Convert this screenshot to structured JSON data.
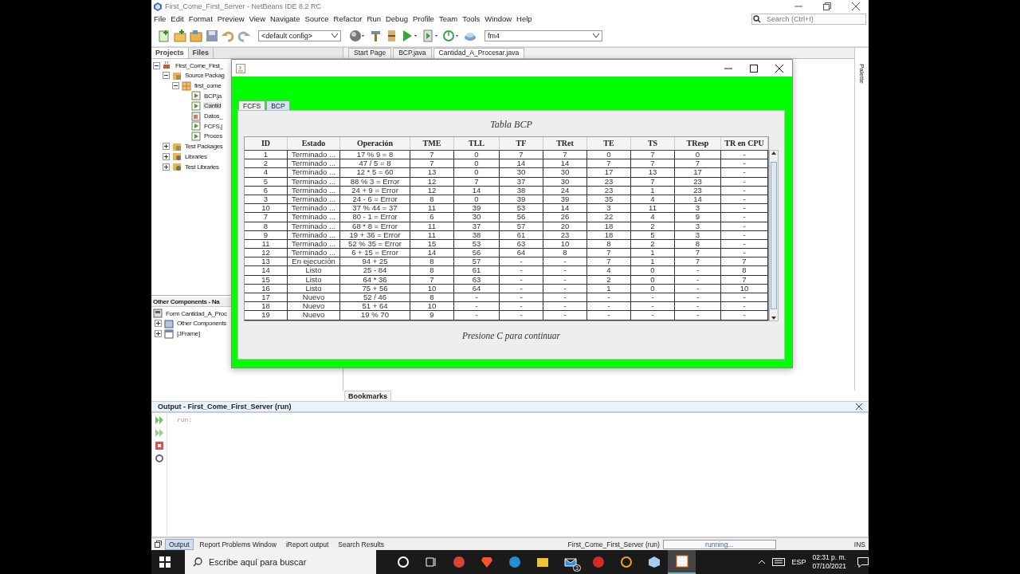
{
  "ide": {
    "title": "First_Come_First_Server - NetBeans IDE 8.2 RC",
    "menu": [
      "File",
      "Edit",
      "Format",
      "Preview",
      "View",
      "Navigate",
      "Source",
      "Refactor",
      "Run",
      "Debug",
      "Profile",
      "Team",
      "Tools",
      "Window",
      "Help"
    ],
    "toolbar": {
      "config": "<default config>",
      "target": "fm4",
      "search_placeholder": "Search (Ctrl+I)"
    },
    "project_tabs": [
      {
        "label": "Projects",
        "selected": true
      },
      {
        "label": "Files",
        "selected": false
      }
    ],
    "project_tree": [
      {
        "label": "First_Come_First_",
        "kind": "project",
        "expanded": true,
        "children": [
          {
            "label": "Source Packag",
            "kind": "folder",
            "expanded": true,
            "children": [
              {
                "label": "first_come",
                "kind": "package",
                "expanded": true,
                "children": [
                  {
                    "label": "BCP.ja",
                    "kind": "java",
                    "selected": false
                  },
                  {
                    "label": "Cantid",
                    "kind": "java",
                    "selected": true
                  },
                  {
                    "label": "Datos_",
                    "kind": "form",
                    "selected": false
                  },
                  {
                    "label": "FCFS.j",
                    "kind": "java",
                    "selected": false
                  },
                  {
                    "label": "Proces",
                    "kind": "java",
                    "selected": false
                  }
                ]
              }
            ]
          },
          {
            "label": "Test Packages",
            "kind": "folder",
            "expanded": false
          },
          {
            "label": "Libraries",
            "kind": "library",
            "expanded": false
          },
          {
            "label": "Test Libraries",
            "kind": "library",
            "expanded": false
          }
        ]
      }
    ],
    "navigator": {
      "title": "Other Components - Na",
      "items": [
        {
          "label": "Form Cantidad_A_Proc",
          "kind": "form"
        },
        {
          "label": "Other Components",
          "kind": "folder",
          "expanded": false
        },
        {
          "label": "[JFrame]",
          "kind": "frame",
          "expanded": false
        }
      ]
    },
    "editor_tabs": [
      {
        "label": "Start Page",
        "selected": false
      },
      {
        "label": "BCP.java",
        "selected": false
      },
      {
        "label": "Cantidad_A_Procesar.java",
        "selected": true
      }
    ],
    "side_panel": "Palette",
    "bookmarks_tab": "Bookmarks",
    "output": {
      "title": "Output - First_Come_First_Server (run)",
      "lines": [
        "run:"
      ]
    },
    "status_bar": {
      "tabs": [
        {
          "label": "Output",
          "selected": true
        },
        {
          "label": "Report Problems Window",
          "selected": false
        },
        {
          "label": "iReport output",
          "selected": false
        },
        {
          "label": "Search Results",
          "selected": false
        }
      ],
      "task": "First_Come_First_Server (run)",
      "progress": "running...",
      "mode": "INS"
    }
  },
  "app_window": {
    "tabs": [
      {
        "label": "FCFS",
        "selected": false
      },
      {
        "label": "BCP",
        "selected": true
      }
    ],
    "table_title": "Tabla BCP",
    "columns": [
      "ID",
      "Estado",
      "Operación",
      "TME",
      "TLL",
      "TF",
      "TRet",
      "TE",
      "TS",
      "TResp",
      "TR en CPU"
    ],
    "rows": [
      [
        "1",
        "Terminado ...",
        "17 % 9 = 8",
        "7",
        "0",
        "7",
        "7",
        "0",
        "7",
        "0",
        "-"
      ],
      [
        "2",
        "Terminado ...",
        "47 / 5 = 8",
        "7",
        "0",
        "14",
        "14",
        "7",
        "7",
        "7",
        "-"
      ],
      [
        "4",
        "Terminado ...",
        "12 * 5 = 60",
        "13",
        "0",
        "30",
        "30",
        "17",
        "13",
        "17",
        "-"
      ],
      [
        "5",
        "Terminado ...",
        "88 % 3 = Error",
        "12",
        "7",
        "37",
        "30",
        "23",
        "7",
        "23",
        "-"
      ],
      [
        "6",
        "Terminado ...",
        "24 + 9 = Error",
        "12",
        "14",
        "38",
        "24",
        "23",
        "1",
        "23",
        "-"
      ],
      [
        "3",
        "Terminado ...",
        "24 - 6 = Error",
        "8",
        "0",
        "39",
        "39",
        "35",
        "4",
        "14",
        "-"
      ],
      [
        "10",
        "Terminado ...",
        "37 % 44 = 37",
        "11",
        "39",
        "53",
        "14",
        "3",
        "11",
        "3",
        "-"
      ],
      [
        "7",
        "Terminado ...",
        "80 - 1 = Error",
        "6",
        "30",
        "56",
        "26",
        "22",
        "4",
        "9",
        "-"
      ],
      [
        "8",
        "Terminado ...",
        "68 * 8 = Error",
        "11",
        "37",
        "57",
        "20",
        "18",
        "2",
        "3",
        "-"
      ],
      [
        "9",
        "Terminado ...",
        "19 + 36 = Error",
        "11",
        "38",
        "61",
        "23",
        "18",
        "5",
        "3",
        "-"
      ],
      [
        "11",
        "Terminado ...",
        "52 % 35 = Error",
        "15",
        "53",
        "63",
        "10",
        "8",
        "2",
        "8",
        "-"
      ],
      [
        "12",
        "Terminado ...",
        "6 + 15 = Error",
        "14",
        "56",
        "64",
        "8",
        "7",
        "1",
        "7",
        "-"
      ],
      [
        "13",
        "En ejecución",
        "94 + 25",
        "8",
        "57",
        "-",
        "-",
        "7",
        "1",
        "7",
        "7"
      ],
      [
        "14",
        "Listo",
        "25 - 84",
        "8",
        "61",
        "-",
        "-",
        "4",
        "0",
        "-",
        "8"
      ],
      [
        "15",
        "Listo",
        "64 * 36",
        "7",
        "63",
        "-",
        "-",
        "2",
        "0",
        "-",
        "7"
      ],
      [
        "16",
        "Listo",
        "75 + 56",
        "10",
        "64",
        "-",
        "-",
        "1",
        "0",
        "-",
        "10"
      ],
      [
        "17",
        "Nuevo",
        "52 / 46",
        "8",
        "-",
        "-",
        "-",
        "-",
        "-",
        "-",
        "-"
      ],
      [
        "18",
        "Nuevo",
        "51 + 64",
        "10",
        "-",
        "-",
        "-",
        "-",
        "-",
        "-",
        "-"
      ],
      [
        "19",
        "Nuevo",
        "19 % 70",
        "9",
        "-",
        "-",
        "-",
        "-",
        "-",
        "-",
        "-"
      ]
    ],
    "footer": "Presione C para continuar"
  },
  "taskbar": {
    "search_placeholder": "Escribe aquí para buscar",
    "apps": [
      {
        "kind": "search_ring",
        "selected": false
      },
      {
        "kind": "task_view",
        "selected": false
      },
      {
        "kind": "chrome",
        "selected": false
      },
      {
        "kind": "brave",
        "selected": false
      },
      {
        "kind": "edge",
        "selected": false
      },
      {
        "kind": "explorer",
        "selected": false
      },
      {
        "kind": "mail",
        "badge": "3",
        "selected": false
      },
      {
        "kind": "game",
        "selected": false
      },
      {
        "kind": "ring",
        "selected": false
      },
      {
        "kind": "cube",
        "selected": false
      },
      {
        "kind": "java",
        "selected": true
      }
    ],
    "language": "ESP",
    "time": "02:31 p. m.",
    "date": "07/10/2021"
  }
}
